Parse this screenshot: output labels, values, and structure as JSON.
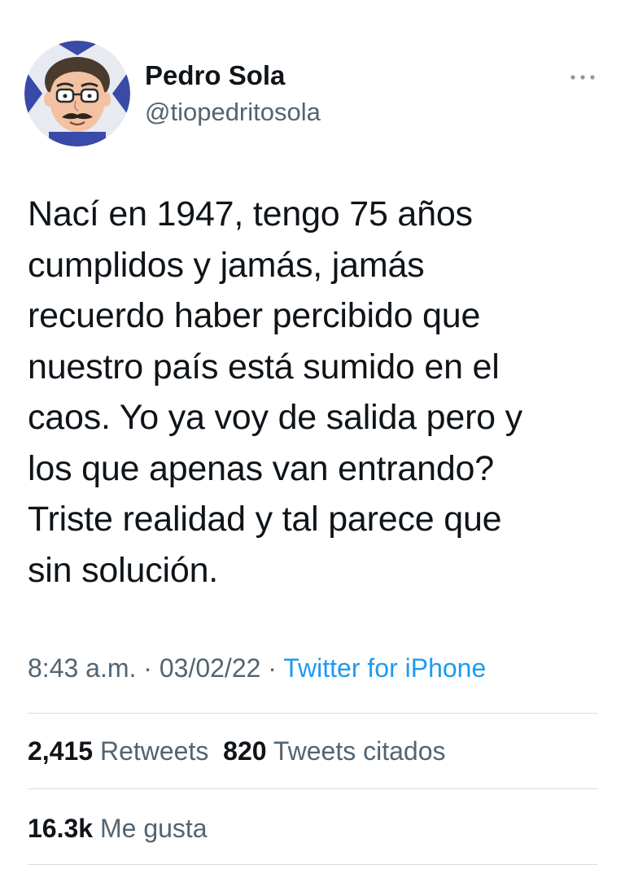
{
  "author": {
    "name": "Pedro Sola",
    "handle": "@tiopedritosola",
    "avatar_icon": "cartoon-avatar-icon"
  },
  "more_icon": "ellipsis-icon",
  "tweet": {
    "text": "Nací en 1947, tengo 75 años\ncumplidos y jamás, jamás\nrecuerdo haber percibido que\nnuestro país está sumido en el\ncaos. Yo ya voy de salida pero y\nlos que apenas van entrando?\nTriste realidad y tal parece que\nsin solución.",
    "time": "8:43 a.m.",
    "separator": "·",
    "date": "03/02/22",
    "source": "Twitter for iPhone"
  },
  "stats": {
    "retweets_count": "2,415",
    "retweets_label": "Retweets",
    "quotes_count": "820",
    "quotes_label": "Tweets citados",
    "likes_count": "16.3k",
    "likes_label": "Me gusta"
  },
  "colors": {
    "text": "#0f1419",
    "secondary": "#536471",
    "link": "#1d9bf0",
    "divider": "#d5dde3"
  }
}
